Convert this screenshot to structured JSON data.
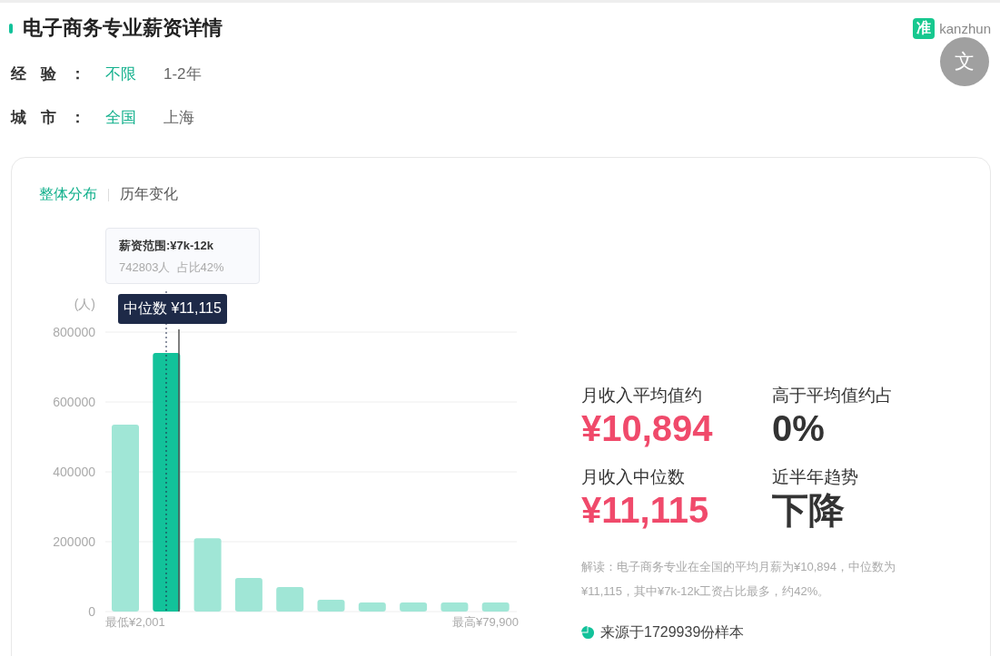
{
  "title": "电子商务专业薪资详情",
  "logo": {
    "mark": "准",
    "text": "kanzhun"
  },
  "translate_button": {
    "label": "文"
  },
  "filters": [
    {
      "label": "经验：",
      "options": [
        {
          "label": "不限",
          "selected": true
        },
        {
          "label": "1-2年",
          "selected": false
        }
      ]
    },
    {
      "label": "城市：",
      "options": [
        {
          "label": "全国",
          "selected": true
        },
        {
          "label": "上海",
          "selected": false
        }
      ]
    }
  ],
  "tabs": [
    {
      "label": "整体分布",
      "selected": true
    },
    {
      "label": "历年变化",
      "selected": false
    }
  ],
  "chart": {
    "tooltip": {
      "title": "薪资范围:¥7k-12k",
      "detail": "742803人  占比42%"
    },
    "median_label": "中位数 ¥11,115",
    "min_label": "最低¥2,001",
    "max_label": "最高¥79,900",
    "bars": [
      {
        "selected": false
      },
      {
        "selected": true
      },
      {
        "selected": false
      },
      {
        "selected": false
      },
      {
        "selected": false
      },
      {
        "selected": false
      },
      {
        "selected": false
      },
      {
        "selected": false
      },
      {
        "selected": false
      },
      {
        "selected": false
      }
    ],
    "chart_data": {
      "type": "bar",
      "ylabel": "(人)",
      "ylim": [
        0,
        800000
      ],
      "yticks": [
        0,
        200000,
        400000,
        600000,
        800000
      ],
      "grid": true,
      "values": [
        535000,
        740000,
        210000,
        96000,
        70000,
        34000,
        26000,
        26000,
        26000,
        26000
      ]
    }
  },
  "stats": [
    {
      "label": "月收入平均值约",
      "value": "¥10,894",
      "kind": "money"
    },
    {
      "label": "高于平均值约占",
      "value": "0%",
      "kind": "plain"
    },
    {
      "label": "月收入中位数",
      "value": "¥11,115",
      "kind": "money"
    },
    {
      "label": "近半年趋势",
      "value": "下降",
      "kind": "plain"
    }
  ],
  "note": "解读：电子商务专业在全国的平均月薪为¥10,894，中位数为¥11,115，其中¥7k-12k工资占比最多，约42%。",
  "source": "来源于1729939份样本"
}
